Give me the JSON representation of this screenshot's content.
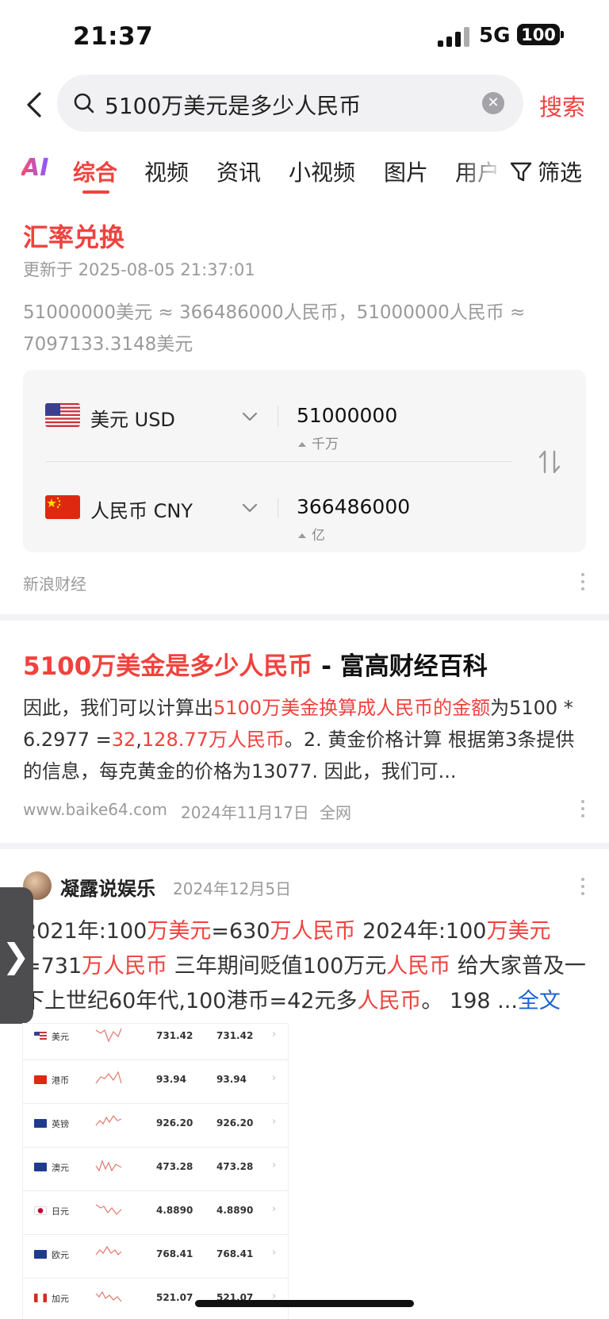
{
  "status_bar": {
    "time": "21:37",
    "network": "5G",
    "battery": "100"
  },
  "search": {
    "query": "5100万美元是多少人民币",
    "button_label": "搜索"
  },
  "tabs": [
    "AI",
    "综合",
    "视频",
    "资讯",
    "小视频",
    "图片",
    "用户"
  ],
  "active_tab": "综合",
  "filter_label": "筛选",
  "exchange": {
    "title": "汇率兑换",
    "updated": "更新于 2025-08-05 21:37:01",
    "summary": "51000000美元 ≈ 366486000人民币，51000000人民币 ≈ 7097133.3148美元",
    "from": {
      "name": "美元 USD",
      "amount": "51000000",
      "unit": "千万"
    },
    "to": {
      "name": "人民币 CNY",
      "amount": "366486000",
      "unit": "亿"
    },
    "source": "新浪财经"
  },
  "result1": {
    "title_hl": "5100万美金是多少人民币",
    "title_rest": " - 富高财经百科",
    "body": [
      {
        "t": "因此，我们可以计算出",
        "hl": false
      },
      {
        "t": "5100万美金换算成人民币的金额",
        "hl": true
      },
      {
        "t": "为5100 * 6.2977 =",
        "hl": false
      },
      {
        "t": "32",
        "hl": true
      },
      {
        "t": ",",
        "hl": false
      },
      {
        "t": "128.77万人民币",
        "hl": true
      },
      {
        "t": "。2. 黄金价格计算 根据第3条提供的信息，每克黄金的价格为13077. 因此，我们可...",
        "hl": false
      }
    ],
    "site": "www.baike64.com",
    "date": "2024年11月17日",
    "scope": "全网"
  },
  "result2": {
    "author": "凝露说娱乐",
    "date": "2024年12月5日",
    "body": [
      {
        "t": "2021年:100",
        "hl": false
      },
      {
        "t": "万美元",
        "hl": true
      },
      {
        "t": "=630",
        "hl": false
      },
      {
        "t": "万人民币",
        "hl": true
      },
      {
        "t": " 2024年:100",
        "hl": false
      },
      {
        "t": "万美元",
        "hl": true
      },
      {
        "t": "=731",
        "hl": false
      },
      {
        "t": "万人民币",
        "hl": true
      },
      {
        "t": " 三年期间贬值100万元",
        "hl": false
      },
      {
        "t": "人民币",
        "hl": true
      },
      {
        "t": " 给大家普及一下上世纪60年代,100港币=42元多",
        "hl": false
      },
      {
        "t": "人民币",
        "hl": true
      },
      {
        "t": "。 198  ...",
        "hl": false
      }
    ],
    "fulltext_label": "全文",
    "table": [
      {
        "name": "美元",
        "v1": "731.42",
        "v2": "731.42",
        "flag": "us"
      },
      {
        "name": "港币",
        "v1": "93.94",
        "v2": "93.94",
        "flag": "hk"
      },
      {
        "name": "英镑",
        "v1": "926.20",
        "v2": "926.20",
        "flag": "uk"
      },
      {
        "name": "澳元",
        "v1": "473.28",
        "v2": "473.28",
        "flag": "au"
      },
      {
        "name": "日元",
        "v1": "4.8890",
        "v2": "4.8890",
        "flag": "jp"
      },
      {
        "name": "欧元",
        "v1": "768.41",
        "v2": "768.41",
        "flag": "eu"
      },
      {
        "name": "加元",
        "v1": "521.07",
        "v2": "521.07",
        "flag": "ca"
      }
    ]
  },
  "colors": {
    "accent": "#f0423e",
    "link": "#1a64d6",
    "muted": "#9a9a9a"
  }
}
